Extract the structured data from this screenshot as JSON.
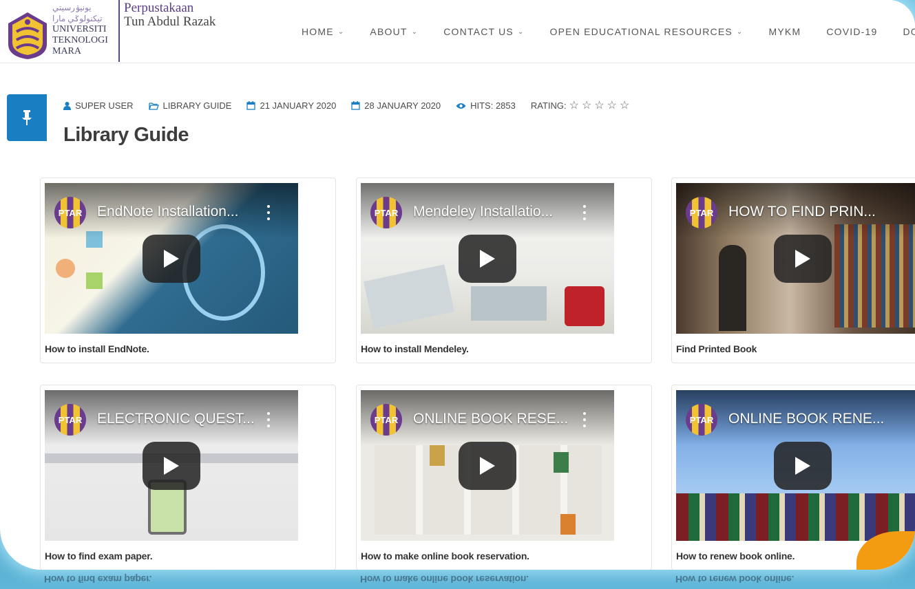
{
  "header": {
    "uitm_jawi": "يونيۏرسيتي تيكنولوݢي مارا",
    "uitm_lines": [
      "UNIVERSITI",
      "TEKNOLOGI",
      "MARA"
    ],
    "library_name_line1": "Perpustakaan",
    "library_name_line2": "Tun Abdul Razak"
  },
  "nav": {
    "items": [
      {
        "label": "HOME",
        "has_dropdown": true
      },
      {
        "label": "ABOUT",
        "has_dropdown": true
      },
      {
        "label": "CONTACT US",
        "has_dropdown": true
      },
      {
        "label": "OPEN EDUCATIONAL RESOURCES",
        "has_dropdown": true
      },
      {
        "label": "MYKM",
        "has_dropdown": false
      },
      {
        "label": "COVID-19",
        "has_dropdown": false
      },
      {
        "label": "DOW",
        "has_dropdown": false
      }
    ],
    "chevron": "⌄"
  },
  "article": {
    "author": "SUPER USER",
    "category": "LIBRARY GUIDE",
    "published": "21 JANUARY 2020",
    "modified": "28 JANUARY 2020",
    "hits": "HITS: 2853",
    "rating_label": "RATING:",
    "rating_stars": 0,
    "title": "Library Guide"
  },
  "videos": [
    {
      "channel": "PTAR",
      "title": "EndNote Installation...",
      "caption": "How to install EndNote."
    },
    {
      "channel": "PTAR",
      "title": "Mendeley Installatio...",
      "caption": "How to install Mendeley."
    },
    {
      "channel": "PTAR",
      "title": "HOW TO FIND PRIN...",
      "caption": "Find Printed Book"
    },
    {
      "channel": "PTAR",
      "title": "ELECTRONIC QUEST...",
      "caption": "How to find exam paper."
    },
    {
      "channel": "PTAR",
      "title": "ONLINE BOOK RESE...",
      "caption": "How to make online book reservation."
    },
    {
      "channel": "PTAR",
      "title": "ONLINE BOOK RENE...",
      "caption": "How to renew book online."
    }
  ],
  "colors": {
    "accent_blue": "#1a7ec3",
    "brand_purple": "#5a3d86",
    "brand_gold": "#f1c232"
  }
}
